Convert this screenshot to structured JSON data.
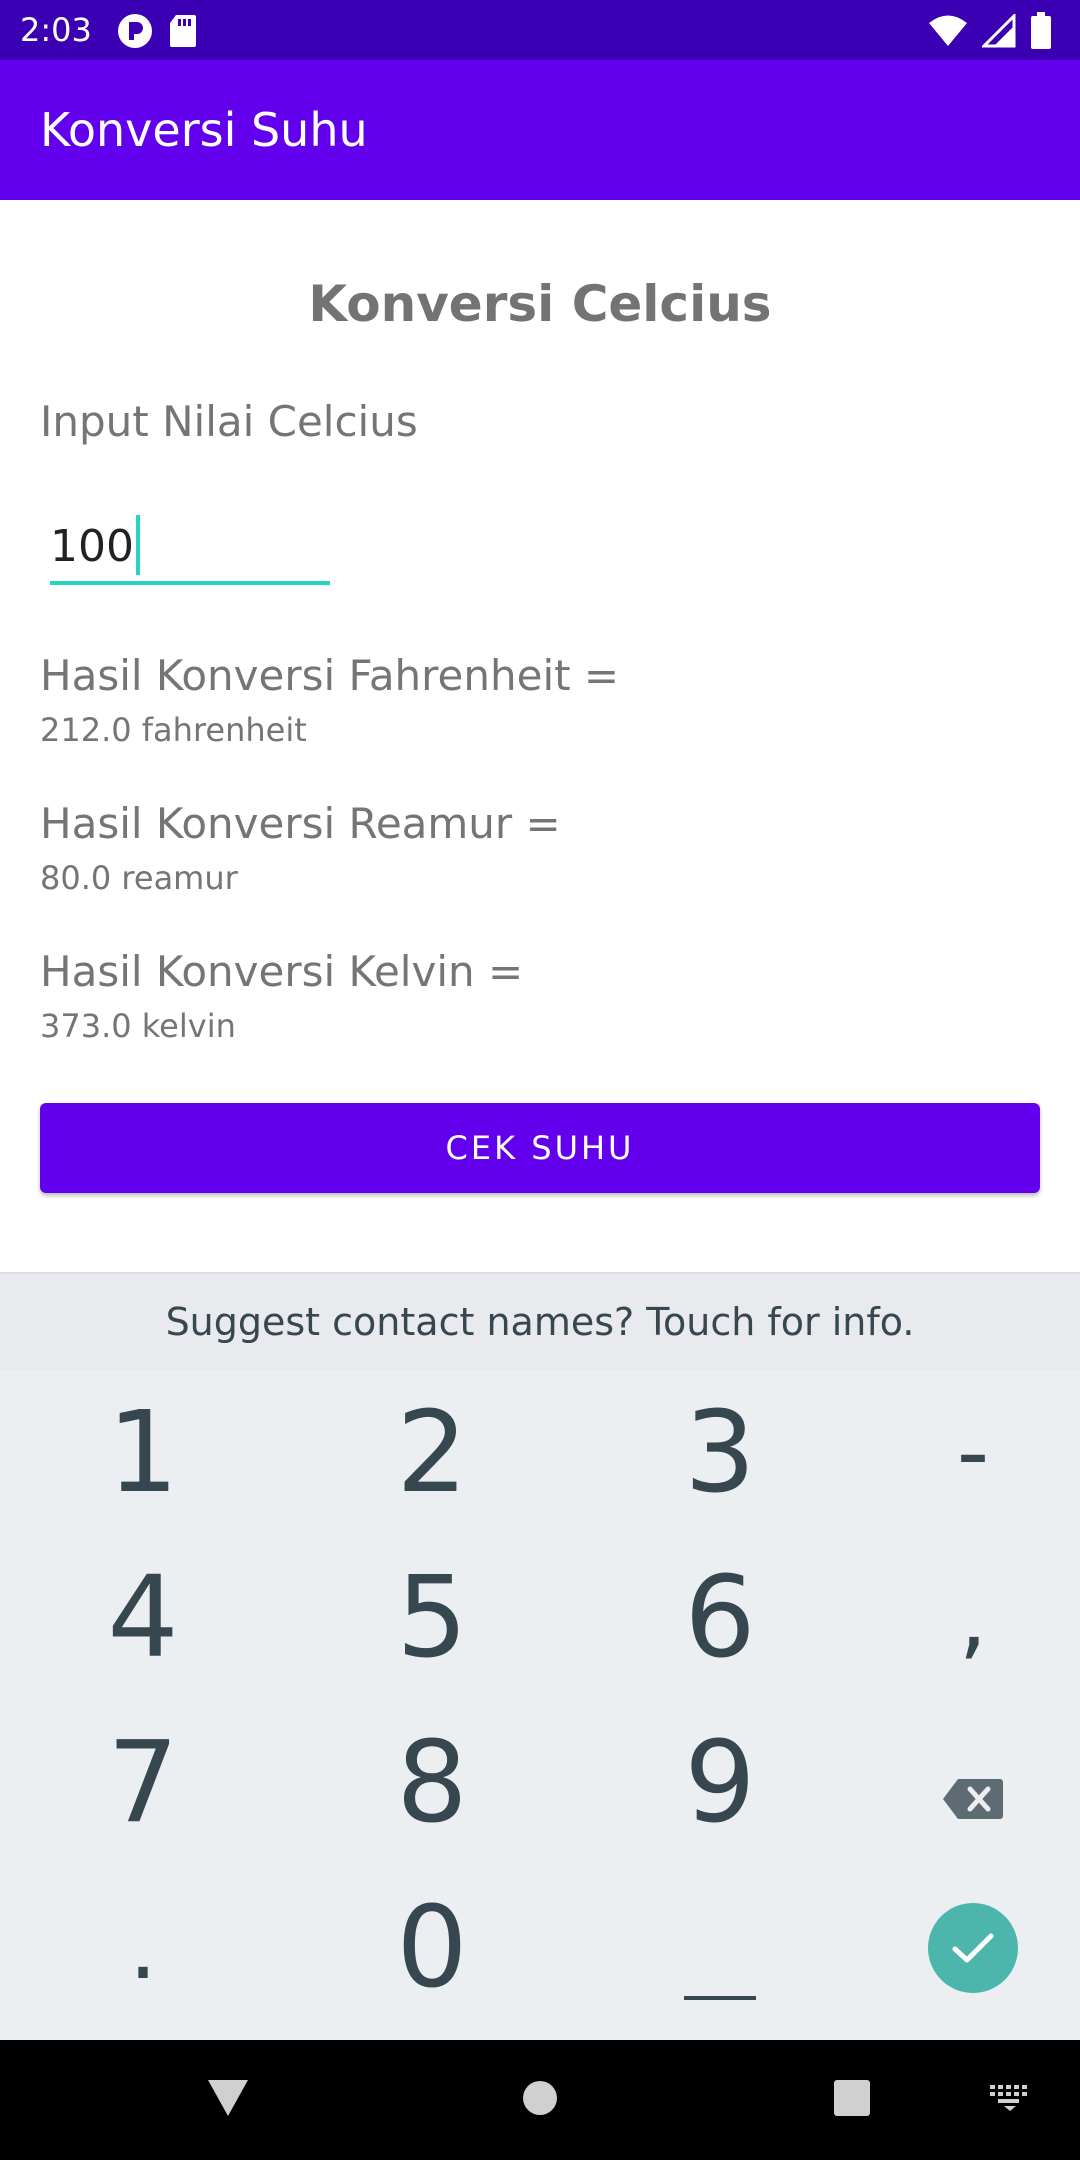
{
  "status_bar": {
    "time": "2:03",
    "left_icons": [
      "app-notification-icon",
      "sd-card-icon"
    ],
    "right_icons": [
      "wifi-icon",
      "cell-signal-icon",
      "battery-icon"
    ]
  },
  "app_bar": {
    "title": "Konversi Suhu"
  },
  "main": {
    "heading": "Konversi Celcius",
    "input_label": "Input Nilai Celcius",
    "celsius_input": {
      "value": "100"
    },
    "results": [
      {
        "label": "Hasil Konversi Fahrenheit =",
        "value": "212.0 fahrenheit"
      },
      {
        "label": "Hasil Konversi Reamur =",
        "value": "80.0 reamur"
      },
      {
        "label": "Hasil Konversi Kelvin =",
        "value": "373.0 kelvin"
      }
    ],
    "button_label": "CEK SUHU"
  },
  "keyboard": {
    "suggestion": "Suggest contact names? Touch for info.",
    "rows": [
      [
        "1",
        "2",
        "3",
        "-"
      ],
      [
        "4",
        "5",
        "6",
        ","
      ],
      [
        "7",
        "8",
        "9",
        "backspace-icon"
      ],
      [
        ".",
        "0",
        "space-icon",
        "done-icon"
      ]
    ]
  },
  "nav_bar": {
    "icons": [
      "back-icon",
      "home-icon",
      "recents-icon",
      "keyboard-switch-icon"
    ]
  },
  "colors": {
    "status_bar": "#3b00b3",
    "app_bar": "#6200ee",
    "accent": "#28d3c2",
    "button": "#6200ee",
    "done_key": "#4db6ac",
    "keyboard_bg": "#eceff1"
  }
}
